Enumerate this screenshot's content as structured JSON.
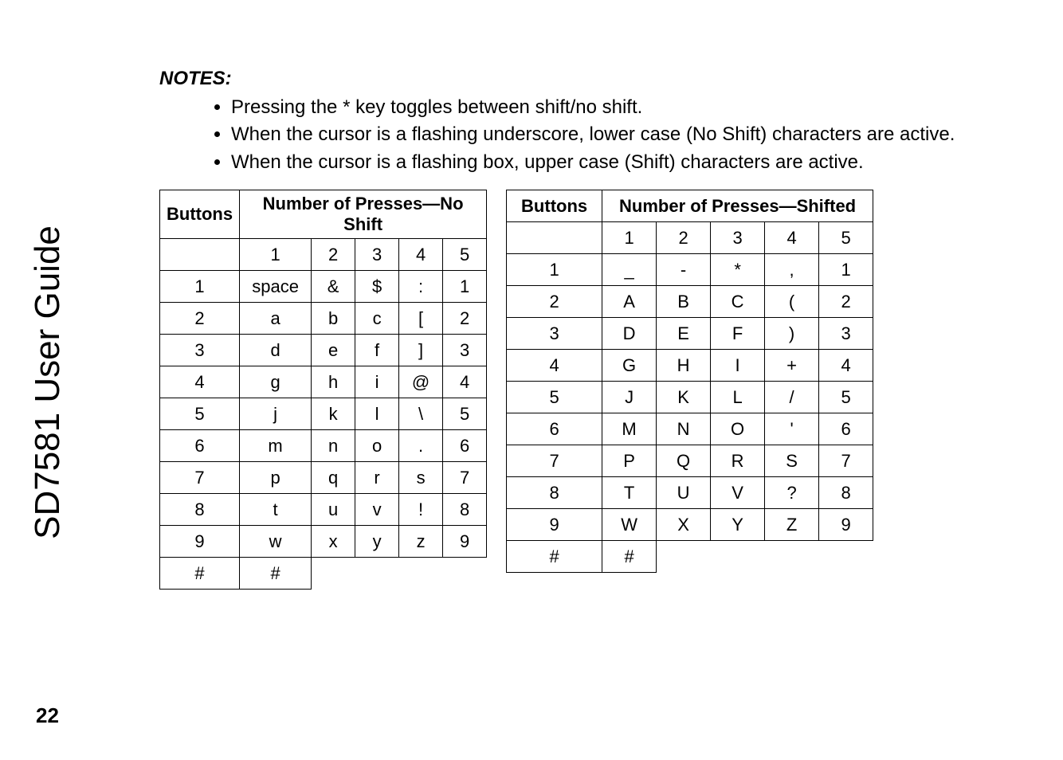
{
  "sidebar_title": "SD7581 User Guide",
  "page_number": "22",
  "notes_heading": "NOTES:",
  "notes": [
    "Pressing the * key toggles between shift/no shift.",
    "When the cursor is a flashing underscore, lower case (No Shift) characters are active.",
    "When the cursor is a flashing box, upper case (Shift) characters are active."
  ],
  "left_table": {
    "header_buttons": "Buttons",
    "header_presses": "Number of Presses—No Shift",
    "press_cols": [
      "1",
      "2",
      "3",
      "4",
      "5"
    ],
    "rows": [
      [
        "1",
        "space",
        "&",
        "$",
        ":",
        "1"
      ],
      [
        "2",
        "a",
        "b",
        "c",
        "[",
        "2"
      ],
      [
        "3",
        "d",
        "e",
        "f",
        "]",
        "3"
      ],
      [
        "4",
        "g",
        "h",
        "i",
        "@",
        "4"
      ],
      [
        "5",
        "j",
        "k",
        "l",
        "\\",
        "5"
      ],
      [
        "6",
        "m",
        "n",
        "o",
        ".",
        "6"
      ],
      [
        "7",
        "p",
        "q",
        "r",
        "s",
        "7"
      ],
      [
        "8",
        "t",
        "u",
        "v",
        "!",
        "8"
      ],
      [
        "9",
        "w",
        "x",
        "y",
        "z",
        "9"
      ],
      [
        "#",
        "#",
        "",
        "",
        "",
        ""
      ]
    ]
  },
  "right_table": {
    "header_buttons": "Buttons",
    "header_presses": "Number of Presses—Shifted",
    "press_cols": [
      "1",
      "2",
      "3",
      "4",
      "5"
    ],
    "rows": [
      [
        "1",
        "_",
        "-",
        "*",
        ",",
        "1"
      ],
      [
        "2",
        "A",
        "B",
        "C",
        "(",
        "2"
      ],
      [
        "3",
        "D",
        "E",
        "F",
        ")",
        "3"
      ],
      [
        "4",
        "G",
        "H",
        "I",
        "+",
        "4"
      ],
      [
        "5",
        "J",
        "K",
        "L",
        "/",
        "5"
      ],
      [
        "6",
        "M",
        "N",
        "O",
        "'",
        "6"
      ],
      [
        "7",
        "P",
        "Q",
        "R",
        "S",
        "7"
      ],
      [
        "8",
        "T",
        "U",
        "V",
        "?",
        "8"
      ],
      [
        "9",
        "W",
        "X",
        "Y",
        "Z",
        "9"
      ],
      [
        "#",
        "#",
        "",
        "",
        "",
        ""
      ]
    ]
  }
}
